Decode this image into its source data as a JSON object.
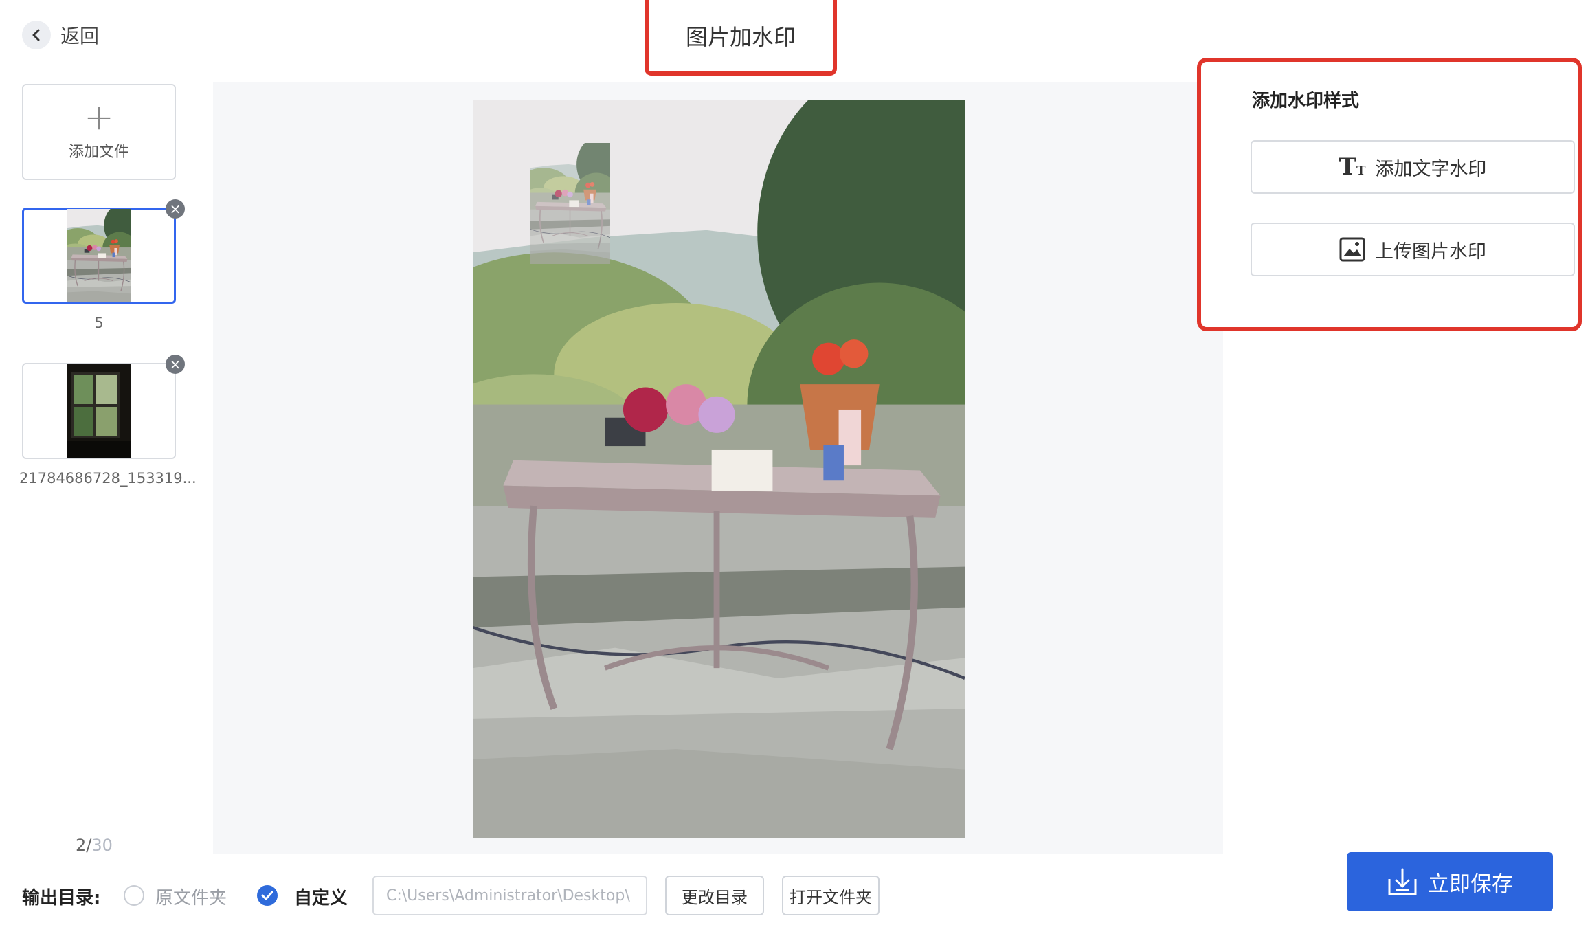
{
  "header": {
    "back_label": "返回",
    "title": "图片加水印"
  },
  "sidebar": {
    "add_file_label": "添加文件",
    "files": [
      {
        "name": "5",
        "selected": true
      },
      {
        "name": "21784686728_153319...",
        "selected": false
      }
    ],
    "pager": {
      "current": "2/",
      "total": "30"
    }
  },
  "watermark_panel": {
    "title": "添加水印样式",
    "text_button_label": "添加文字水印",
    "image_button_label": "上传图片水印"
  },
  "output": {
    "label": "输出目录:",
    "option_original": "原文件夹",
    "option_custom": "自定义",
    "selected": "custom",
    "path_placeholder": "C:\\Users\\Administrator\\Desktop\\",
    "change_dir_label": "更改目录",
    "open_folder_label": "打开文件夹"
  },
  "save_label": "立即保存",
  "colors": {
    "accent": "#2b64dd",
    "highlight_border": "#e0352b"
  }
}
